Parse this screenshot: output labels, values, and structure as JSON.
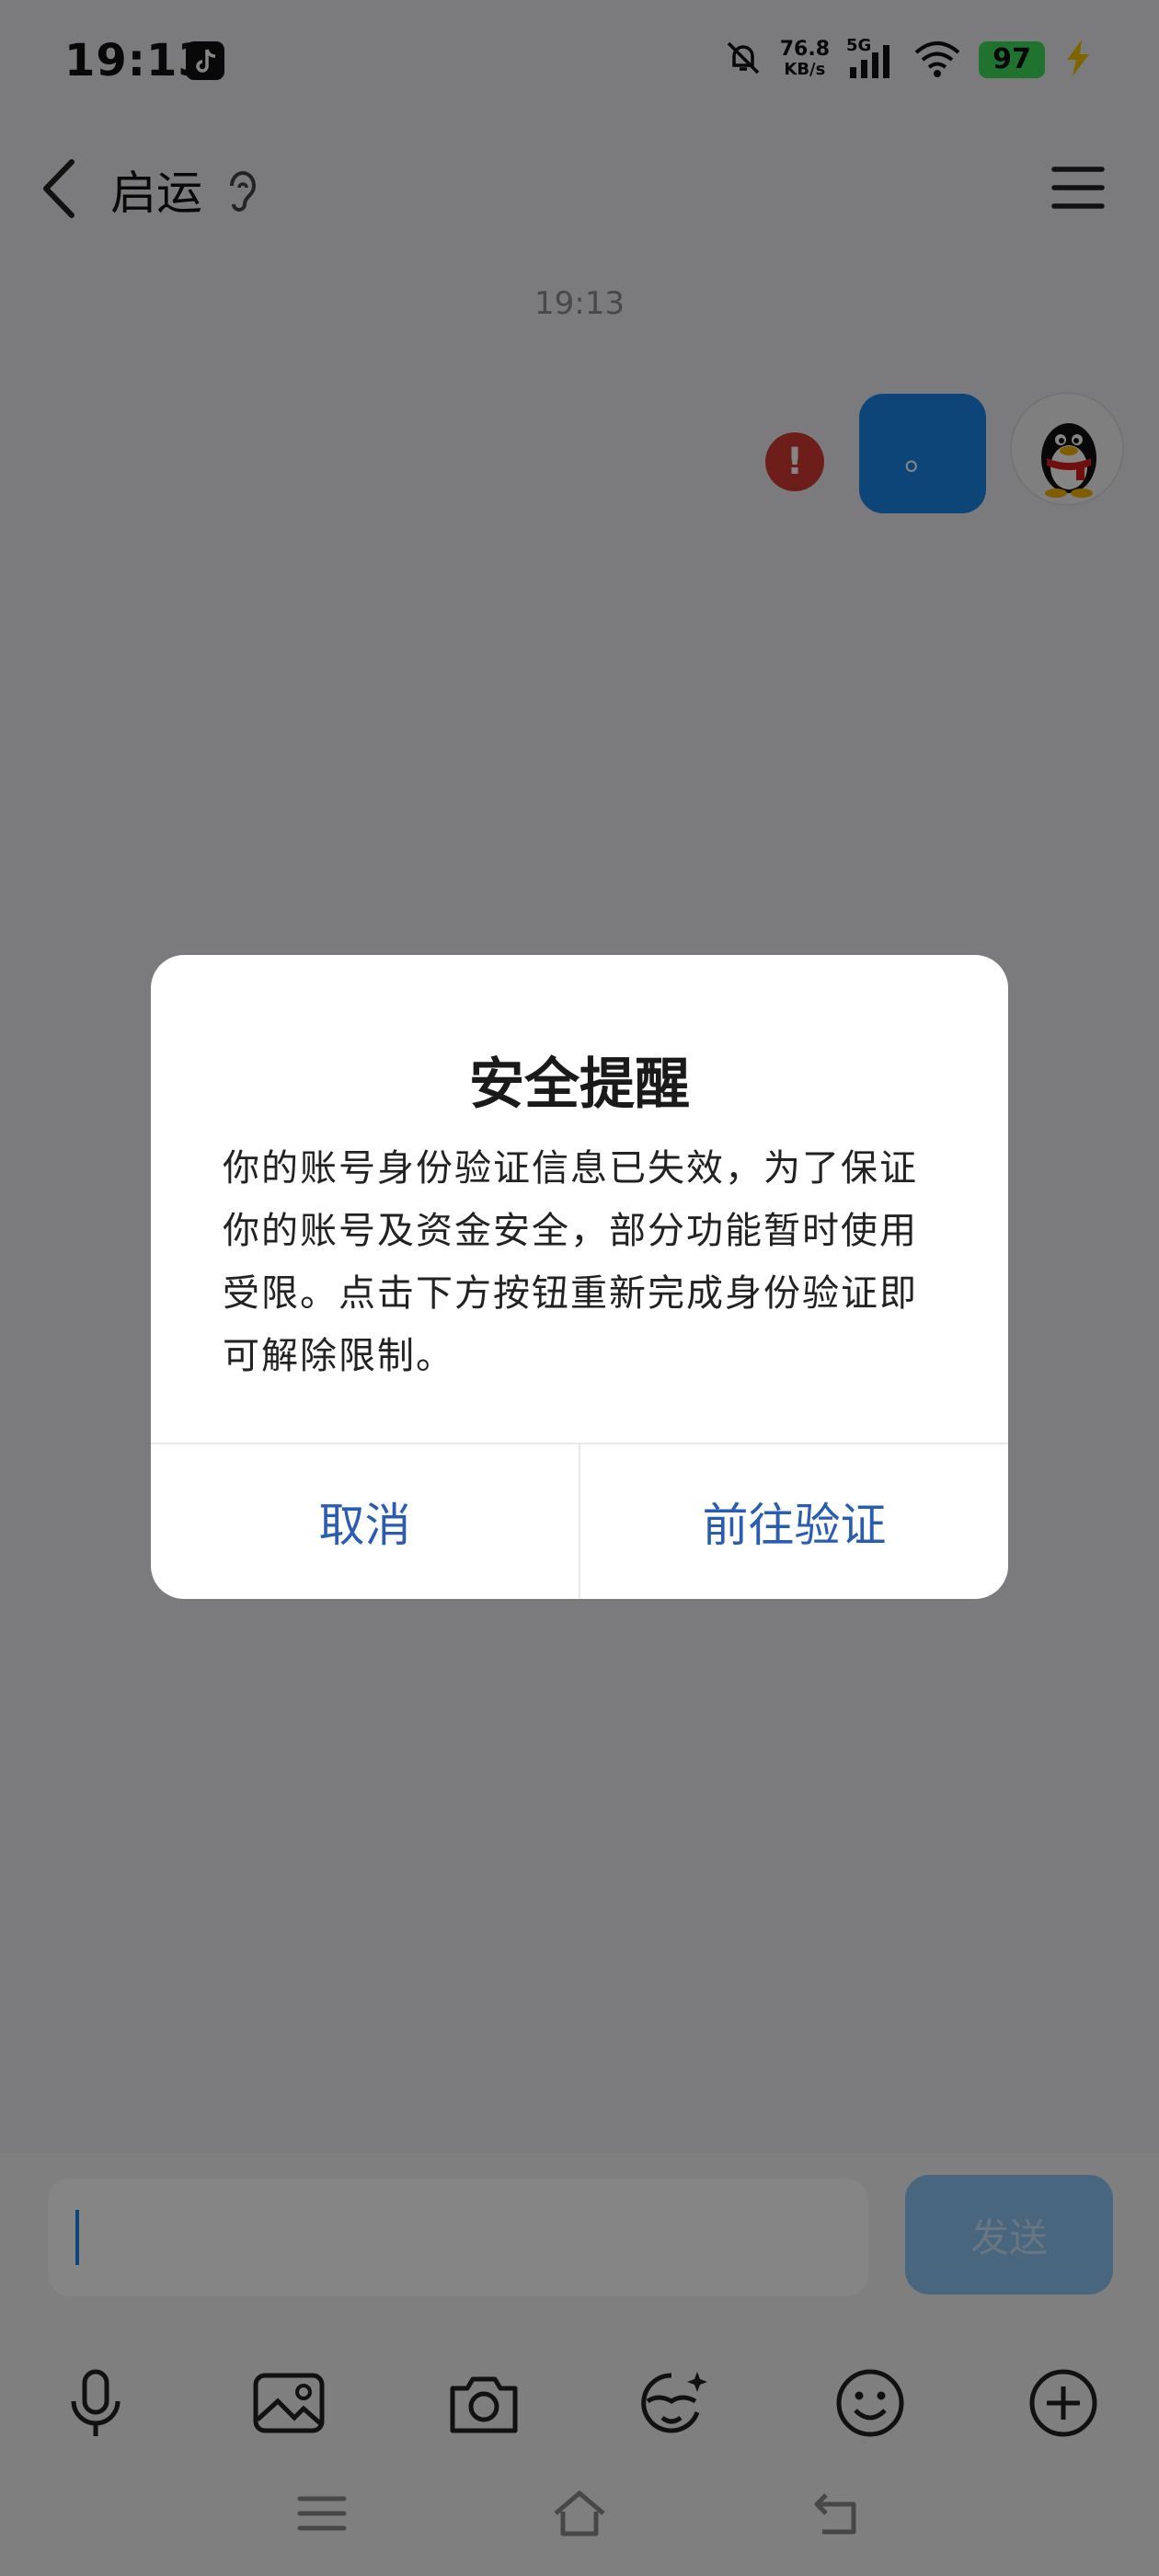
{
  "status_bar": {
    "time": "19:13",
    "net_speed": "76.8",
    "net_unit": "KB/s",
    "network": "5G",
    "battery": "97"
  },
  "header": {
    "contact_name": "启运"
  },
  "chat": {
    "timestamp": "19:13",
    "messages": [
      {
        "text": "。",
        "status": "failed"
      }
    ]
  },
  "input": {
    "send_label": "发送"
  },
  "dialog": {
    "title": "安全提醒",
    "body": "你的账号身份验证信息已失效，为了保证你的账号及资金安全，部分功能暂时使用受限。点击下方按钮重新完成身份验证即可解除限制。",
    "cancel_label": "取消",
    "confirm_label": "前往验证"
  },
  "colors": {
    "accent": "#1a85e8",
    "dialog_button": "#2a5db0",
    "error": "#d23a34",
    "battery": "#3ddc5a"
  },
  "icons": [
    "back-arrow-icon",
    "ear-icon",
    "menu-icon",
    "error-icon",
    "qq-penguin-avatar",
    "mic-icon",
    "image-icon",
    "camera-icon",
    "sticker-icon",
    "emoji-icon",
    "plus-icon",
    "nav-menu-icon",
    "nav-home-icon",
    "nav-back-icon"
  ]
}
